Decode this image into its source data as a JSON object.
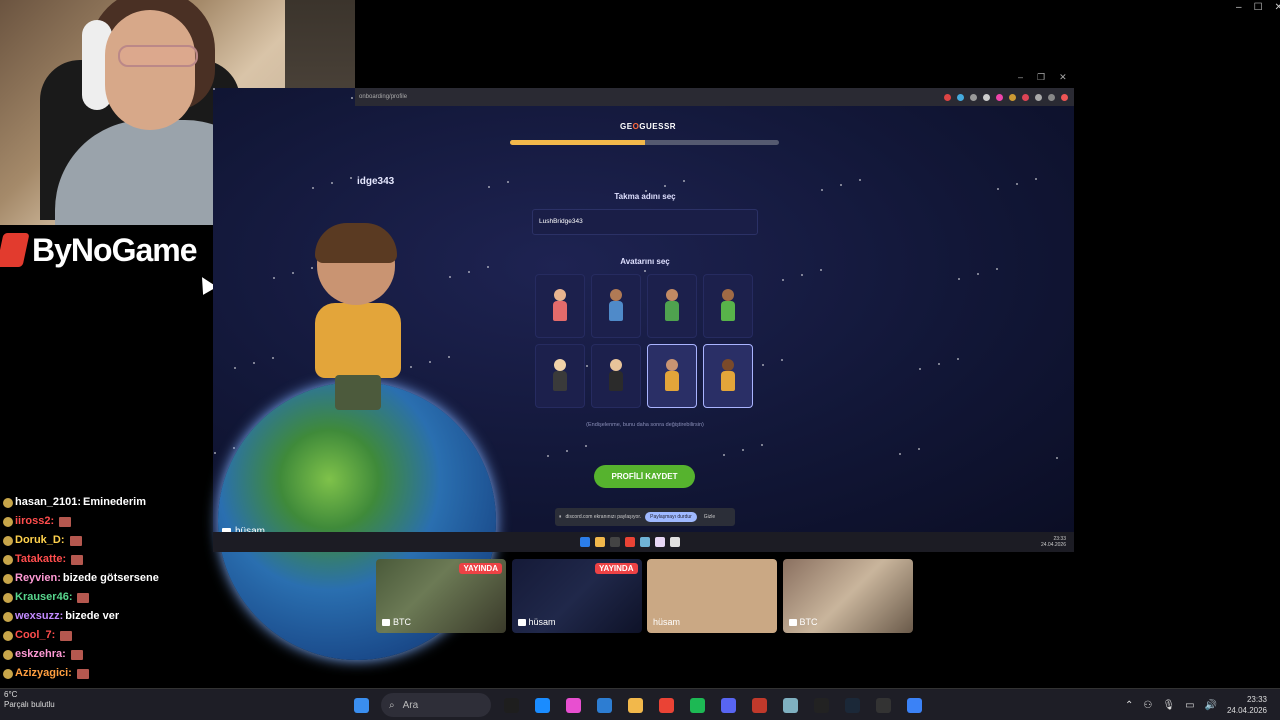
{
  "overlay": {
    "brand": "ByNoGame"
  },
  "chat": [
    {
      "user": "hasan_2101",
      "color": "#ffffff",
      "text": "Eminederim",
      "emote": false
    },
    {
      "user": "iiross2",
      "color": "#ff4d4d",
      "text": "",
      "emote": true
    },
    {
      "user": "Doruk_D",
      "color": "#ffd24d",
      "text": "",
      "emote": true
    },
    {
      "user": "Tatakatte",
      "color": "#ff4d4d",
      "text": "",
      "emote": true
    },
    {
      "user": "Reyvien",
      "color": "#ff9ad5",
      "text": "bizede götsersene",
      "emote": false
    },
    {
      "user": "Krauser46",
      "color": "#58d68d",
      "text": "",
      "emote": true
    },
    {
      "user": "wexsuzz",
      "color": "#c38bff",
      "text": "bizede ver",
      "emote": false
    },
    {
      "user": "Cool_7",
      "color": "#ff4d4d",
      "text": "",
      "emote": true
    },
    {
      "user": "eskzehra",
      "color": "#ff9ad5",
      "text": "",
      "emote": true
    },
    {
      "user": "Azizyagici",
      "color": "#ff9f40",
      "text": "",
      "emote": true
    }
  ],
  "browser": {
    "url": "onboarding/profile"
  },
  "geoguessr": {
    "logo_left": "GE",
    "logo_o": "O",
    "logo_right": "GUESSR",
    "progress": 0.5,
    "nickname_label": "Takma adını seç",
    "nickname_value": "LushBridge343",
    "avatar_label": "Avatarını seç",
    "avatars": [
      {
        "skin": "#e8b48f",
        "shirt": "#e36b6b",
        "selected": false
      },
      {
        "skin": "#b07a55",
        "shirt": "#4f8ac9",
        "selected": false
      },
      {
        "skin": "#c28a63",
        "shirt": "#4fa24f",
        "selected": false
      },
      {
        "skin": "#a06a45",
        "shirt": "#58b34a",
        "selected": false
      },
      {
        "skin": "#f0d2a8",
        "shirt": "#3a3a3a",
        "selected": false
      },
      {
        "skin": "#e8c49a",
        "shirt": "#2b2b2b",
        "selected": false
      },
      {
        "skin": "#c99472",
        "shirt": "#e3a53a",
        "selected": true
      },
      {
        "skin": "#7a4a2a",
        "shirt": "#e3a53a",
        "selected": true
      }
    ],
    "hint": "(Endişelenme, bunu daha sonra değiştirebilirsin)",
    "save_button": "PROFİLİ KAYDET",
    "side_tag": "idge343"
  },
  "share_bar": {
    "text": "discord.com ekranınızı paylaşıyor.",
    "stop": "Paylaşmayı durdur",
    "hide": "Gizle"
  },
  "stream_user": "hüsam",
  "inner_clock": {
    "time": "23:33",
    "date": "24.04.2026"
  },
  "thumbs": [
    {
      "label": "BTC",
      "live": "YAYINDA",
      "bg": "linear-gradient(135deg,#4a5a3a,#6c7a55 40%,#3a3a2a)"
    },
    {
      "label": "hüsam",
      "live": "YAYINDA",
      "bg": "linear-gradient(135deg,#151a38,#20284a 50%,#0e1228)"
    },
    {
      "label": "hüsam",
      "live": "",
      "bg": "#caa884"
    },
    {
      "label": "BTC",
      "live": "",
      "bg": "linear-gradient(135deg,#8a7060,#c9b59c 50%,#6a5a4a)"
    }
  ],
  "weather": {
    "temp": "6°C",
    "desc": "Parçalı bulutlu"
  },
  "taskbar": {
    "search_placeholder": "Ara",
    "time": "23:33",
    "date": "24.04.2026",
    "app_colors": [
      "#1e1e1e",
      "#1a8cff",
      "#e84fd0",
      "#2d7dd2",
      "#f2b84b",
      "#ea4335",
      "#1db954",
      "#5865f2",
      "#c0392b",
      "#7fb0c0",
      "#222222",
      "#1b2838",
      "#333333",
      "#3b82f6"
    ]
  }
}
